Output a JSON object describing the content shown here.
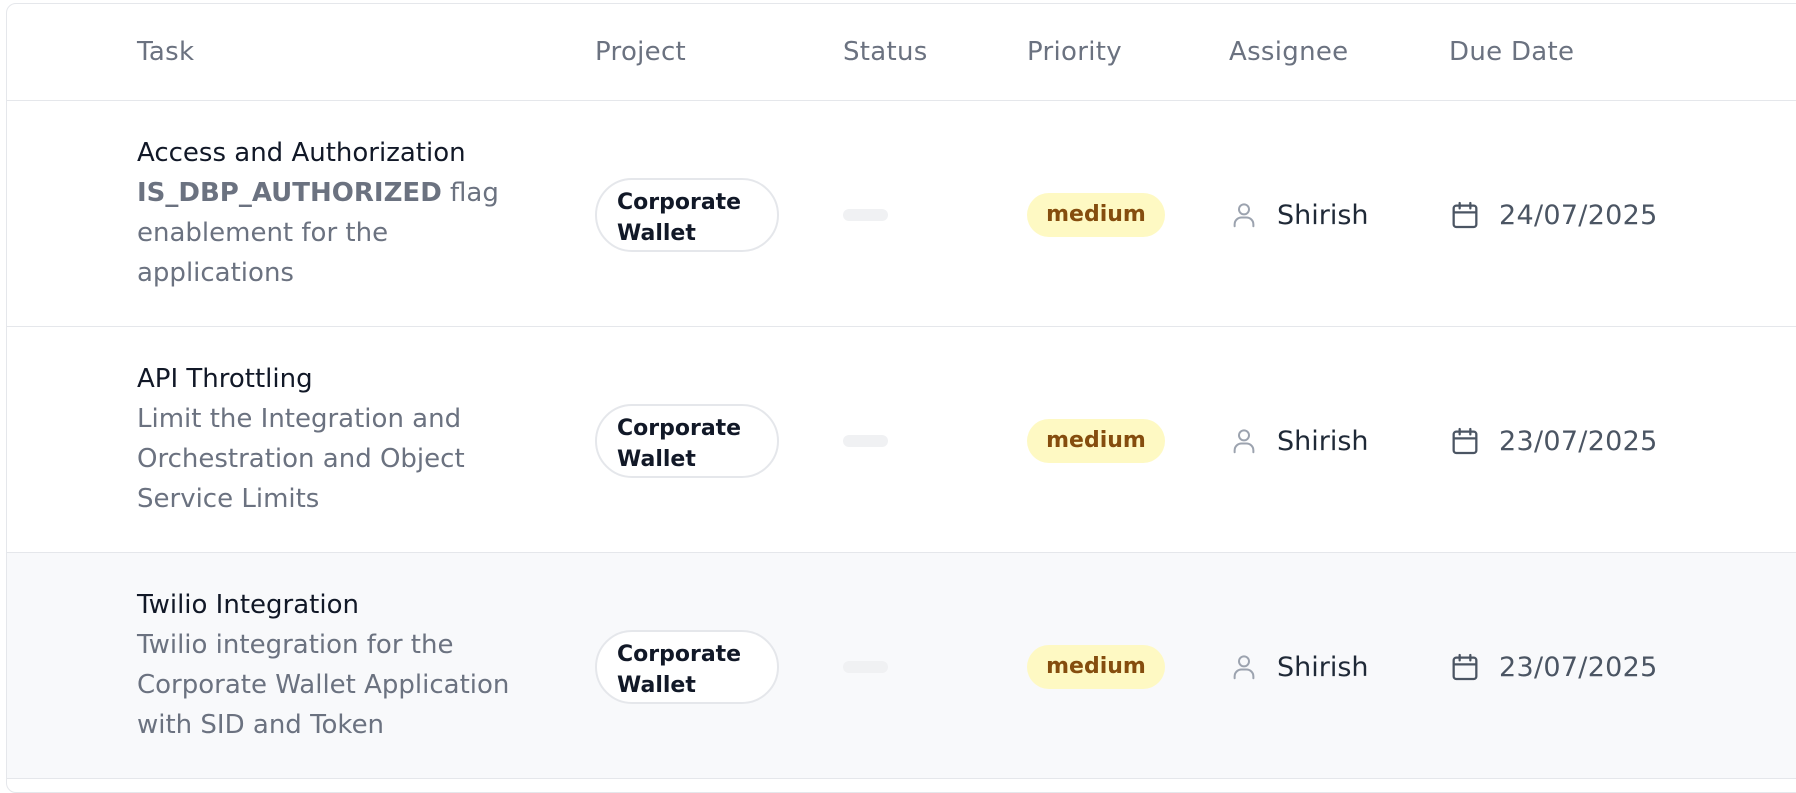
{
  "header": {
    "task": "Task",
    "project": "Project",
    "status": "Status",
    "priority": "Priority",
    "assignee": "Assignee",
    "due_date": "Due Date"
  },
  "rows": [
    {
      "title": "Access and Authorization",
      "desc_bold": "IS_DBP_AUTHORIZED",
      "desc": " flag enablement for the applications",
      "project_line1": "Corporate",
      "project_line2": "Wallet",
      "priority": "medium",
      "assignee": "Shirish",
      "due_date": "24/07/2025"
    },
    {
      "title": "API Throttling",
      "desc_bold": "",
      "desc": "Limit the Integration and Orchestration and Object Service Limits",
      "project_line1": "Corporate",
      "project_line2": "Wallet",
      "priority": "medium",
      "assignee": "Shirish",
      "due_date": "23/07/2025"
    },
    {
      "title": "Twilio Integration",
      "desc_bold": "",
      "desc": "Twilio integration for the Corporate Wallet Application with SID and Token",
      "project_line1": "Corporate",
      "project_line2": "Wallet",
      "priority": "medium",
      "assignee": "Shirish",
      "due_date": "23/07/2025"
    }
  ],
  "icons": {
    "assignee": "user-icon",
    "due_date": "calendar-icon"
  },
  "colors": {
    "priority_medium_bg": "#fef9c3",
    "priority_medium_text": "#854d0e",
    "hover_row_bg": "#f8f9fb"
  }
}
